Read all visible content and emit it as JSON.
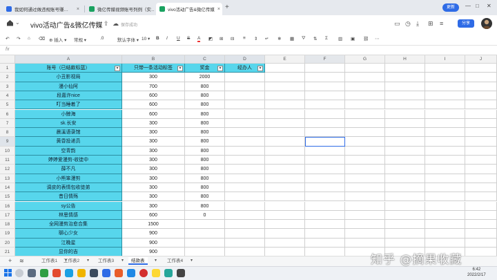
{
  "browser": {
    "tabs": [
      {
        "label": "我如何通过做违规账号赚…",
        "color": "#2e6be6"
      },
      {
        "label": "微亿传媒视频账号列例（实…",
        "color": "#1aa260"
      },
      {
        "label": "vivo活动广告&微亿传媒",
        "color": "#1aa260"
      }
    ],
    "new_tab": "+",
    "update_label": "更新"
  },
  "doc": {
    "title": "vivo活动广告&微亿传媒",
    "saved_text": "保存成功",
    "share_label": "分享"
  },
  "toolbar": {
    "insert": "插入",
    "format": "常规",
    "decimals": ".0",
    "font": "默认字体",
    "size": "10",
    "bold": "B",
    "italic": "I",
    "underline": "U",
    "strike": "S",
    "font_color": "A"
  },
  "formula": {
    "label": "fx"
  },
  "columns": [
    "A",
    "B",
    "C",
    "D",
    "E",
    "F",
    "G",
    "H",
    "I",
    "J"
  ],
  "headers": {
    "a": "账号（已结款标蓝）",
    "b": "只带一条活动标签",
    "c": "奖金",
    "d": "经办人"
  },
  "rows": [
    {
      "n": "2",
      "a": "小丑影视局",
      "b": "300",
      "c": "2000"
    },
    {
      "n": "3",
      "a": "漫小仙阿",
      "b": "700",
      "c": "800"
    },
    {
      "n": "4",
      "a": "段嘉许nice",
      "b": "600",
      "c": "800"
    },
    {
      "n": "5",
      "a": "叮当睡着了",
      "b": "600",
      "c": "800"
    },
    {
      "n": "6",
      "a": "小鲸海",
      "b": "600",
      "c": "800"
    },
    {
      "n": "7",
      "a": "sk.长安",
      "b": "300",
      "c": "800"
    },
    {
      "n": "8",
      "a": "晨溪语录馆",
      "b": "300",
      "c": "800"
    },
    {
      "n": "9",
      "a": "黄昏投递员",
      "b": "300",
      "c": "800"
    },
    {
      "n": "10",
      "a": "空青韵",
      "b": "300",
      "c": "800"
    },
    {
      "n": "11",
      "a": "婷婷爱漫剪-收徒中",
      "b": "300",
      "c": "800"
    },
    {
      "n": "12",
      "a": "薛不凡",
      "b": "300",
      "c": "800"
    },
    {
      "n": "13",
      "a": "小熊笨漫剪",
      "b": "300",
      "c": "800"
    },
    {
      "n": "14",
      "a": "调皮的表情包收徒弟",
      "b": "300",
      "c": "800"
    },
    {
      "n": "15",
      "a": "昔日情殇",
      "b": "300",
      "c": "800"
    },
    {
      "n": "16",
      "a": "sy公告",
      "b": "300",
      "c": "800"
    },
    {
      "n": "17",
      "a": "林思情感",
      "b": "600",
      "c": "0"
    },
    {
      "n": "18",
      "a": "全网漫剪治愈合集",
      "b": "1500",
      "c": ""
    },
    {
      "n": "19",
      "a": "聊心少女",
      "b": "900",
      "c": ""
    },
    {
      "n": "20",
      "a": "江晚星",
      "b": "900",
      "c": ""
    },
    {
      "n": "21",
      "a": "显你的吉",
      "b": "900",
      "c": ""
    }
  ],
  "sheets": [
    "工作表1",
    "工作表2",
    "工作表3",
    "结款表",
    "工作表4"
  ],
  "active_sheet": "结款表",
  "watermark": "知乎 @摘果收藏",
  "taskbar": {
    "time": "6:42",
    "date": "2022/2/17"
  },
  "colors": {
    "accent": "#2e6be6",
    "paid": "#57d6ec"
  }
}
